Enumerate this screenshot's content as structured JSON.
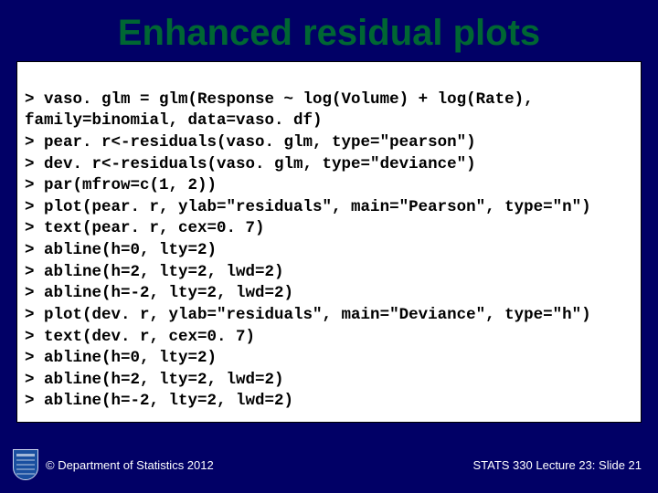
{
  "slide": {
    "title": "Enhanced residual plots"
  },
  "code": {
    "lines": [
      "> vaso. glm = glm(Response ~ log(Volume) + log(Rate), ",
      "family=binomial, data=vaso. df)",
      "> pear. r<-residuals(vaso. glm, type=\"pearson\")",
      "> dev. r<-residuals(vaso. glm, type=\"deviance\")",
      "> par(mfrow=c(1, 2))",
      "> plot(pear. r, ylab=\"residuals\", main=\"Pearson\", type=\"n\")",
      "> text(pear. r, cex=0. 7)",
      "> abline(h=0, lty=2)",
      "> abline(h=2, lty=2, lwd=2)",
      "> abline(h=-2, lty=2, lwd=2)",
      "> plot(dev. r, ylab=\"residuals\", main=\"Deviance\", type=\"h\")",
      "> text(dev. r, cex=0. 7)",
      "> abline(h=0, lty=2)",
      "> abline(h=2, lty=2, lwd=2)",
      "> abline(h=-2, lty=2, lwd=2)"
    ]
  },
  "footer": {
    "copyright": "© Department of Statistics 2012",
    "pageinfo": "STATS 330 Lecture 23: Slide 21"
  }
}
